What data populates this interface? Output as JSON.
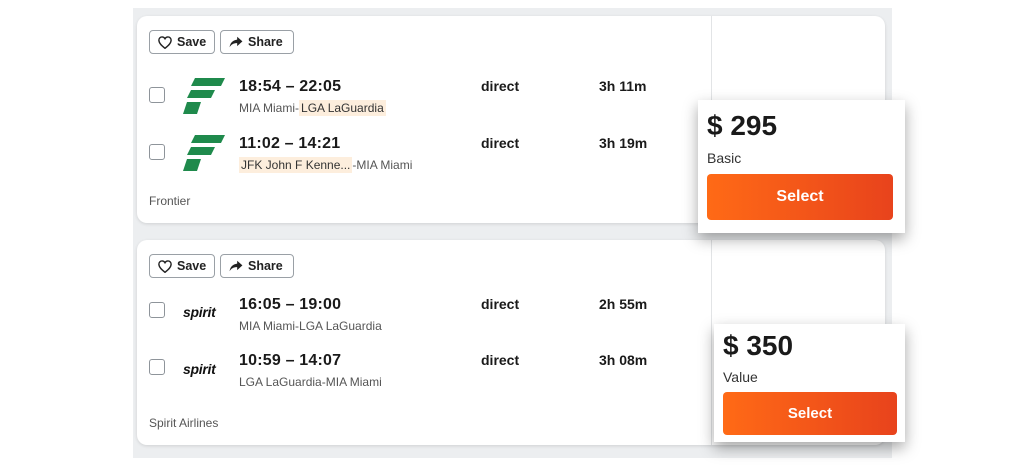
{
  "actions": {
    "save_label": "Save",
    "share_label": "Share"
  },
  "results": [
    {
      "airline": "Frontier",
      "legs": [
        {
          "times": "18:54 – 22:05",
          "origin": "MIA Miami",
          "sep": "-",
          "destination": "LGA LaGuardia",
          "stops": "direct",
          "duration": "3h 11m"
        },
        {
          "times": "11:02 – 14:21",
          "origin": "JFK John F Kenne...",
          "sep": "-",
          "destination": "MIA Miami",
          "stops": "direct",
          "duration": "3h 19m"
        }
      ],
      "price": "$ 295",
      "fare": "Basic",
      "select_label": "Select"
    },
    {
      "airline": "Spirit Airlines",
      "logo_text": "spirit",
      "legs": [
        {
          "times": "16:05 – 19:00",
          "origin": "MIA Miami",
          "sep": "-",
          "destination": "LGA LaGuardia",
          "stops": "direct",
          "duration": "2h 55m"
        },
        {
          "times": "10:59 – 14:07",
          "origin": "LGA LaGuardia",
          "sep": "-",
          "destination": "MIA Miami",
          "stops": "direct",
          "duration": "3h 08m"
        }
      ],
      "price": "$ 350",
      "fare": "Value",
      "select_label": "Select"
    }
  ],
  "colors": {
    "accent_start": "#ff6a16",
    "accent_end": "#e8431c",
    "frontier_green": "#1f8a4c",
    "highlight": "#fdeedd"
  },
  "icons": {
    "save": "heart-icon",
    "share": "share-arrow-icon",
    "frontier_logo": "frontier-logo",
    "spirit_logo": "spirit-logo"
  }
}
